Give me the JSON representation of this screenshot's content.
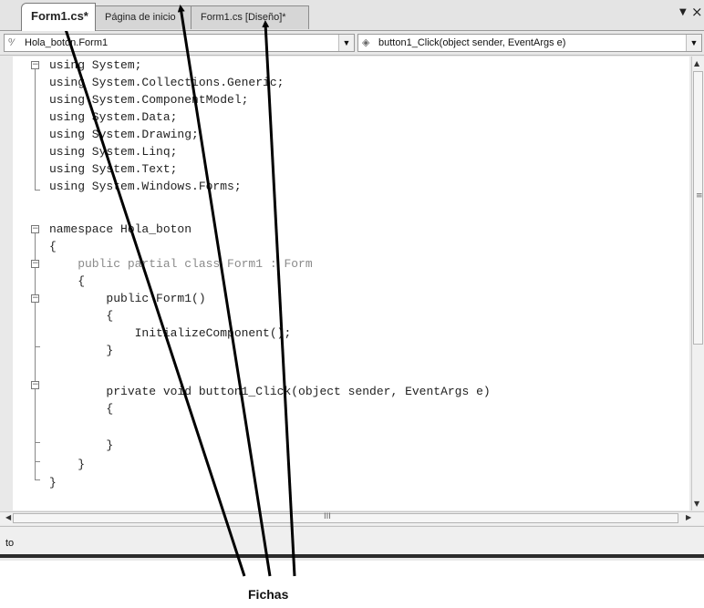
{
  "tabs": [
    {
      "label": "Form1.cs*",
      "active": true
    },
    {
      "label": "Página de inicio",
      "active": false
    },
    {
      "label": "Form1.cs [Diseño]*",
      "active": false
    }
  ],
  "tab_controls": {
    "menu_icon": "dropdown-arrow-icon",
    "close_icon": "close-icon",
    "menu_glyph": "▼",
    "close_glyph": "×"
  },
  "class_dropdown": {
    "value": "Hola_boton.Form1",
    "icon": "class-icon"
  },
  "member_dropdown": {
    "value": "button1_Click(object sender, EventArgs e)",
    "icon": "method-icon"
  },
  "code_lines": [
    "using System;",
    "using System.Collections.Generic;",
    "using System.ComponentModel;",
    "using System.Data;",
    "using System.Drawing;",
    "using System.Linq;",
    "using System.Text;",
    "using System.Windows.Forms;",
    "",
    "namespace Hola_boton",
    "{",
    "    public partial class Form1 : Form",
    "    {",
    "        public Form1()",
    "        {",
    "            InitializeComponent();",
    "        }",
    "",
    "        private void button1_Click(object sender, EventArgs e)",
    "        {",
    "",
    "        }",
    "    }",
    "}"
  ],
  "horizontal_scrollbar": {
    "grip": "III"
  },
  "vertical_scrollbar": {
    "grip": "≡"
  },
  "status_bar": {
    "text": "to"
  },
  "annotation": {
    "caption": "Fichas"
  },
  "colors": {
    "text": "#222222",
    "type_name": "#8a8a8a",
    "background": "#ffffff"
  }
}
